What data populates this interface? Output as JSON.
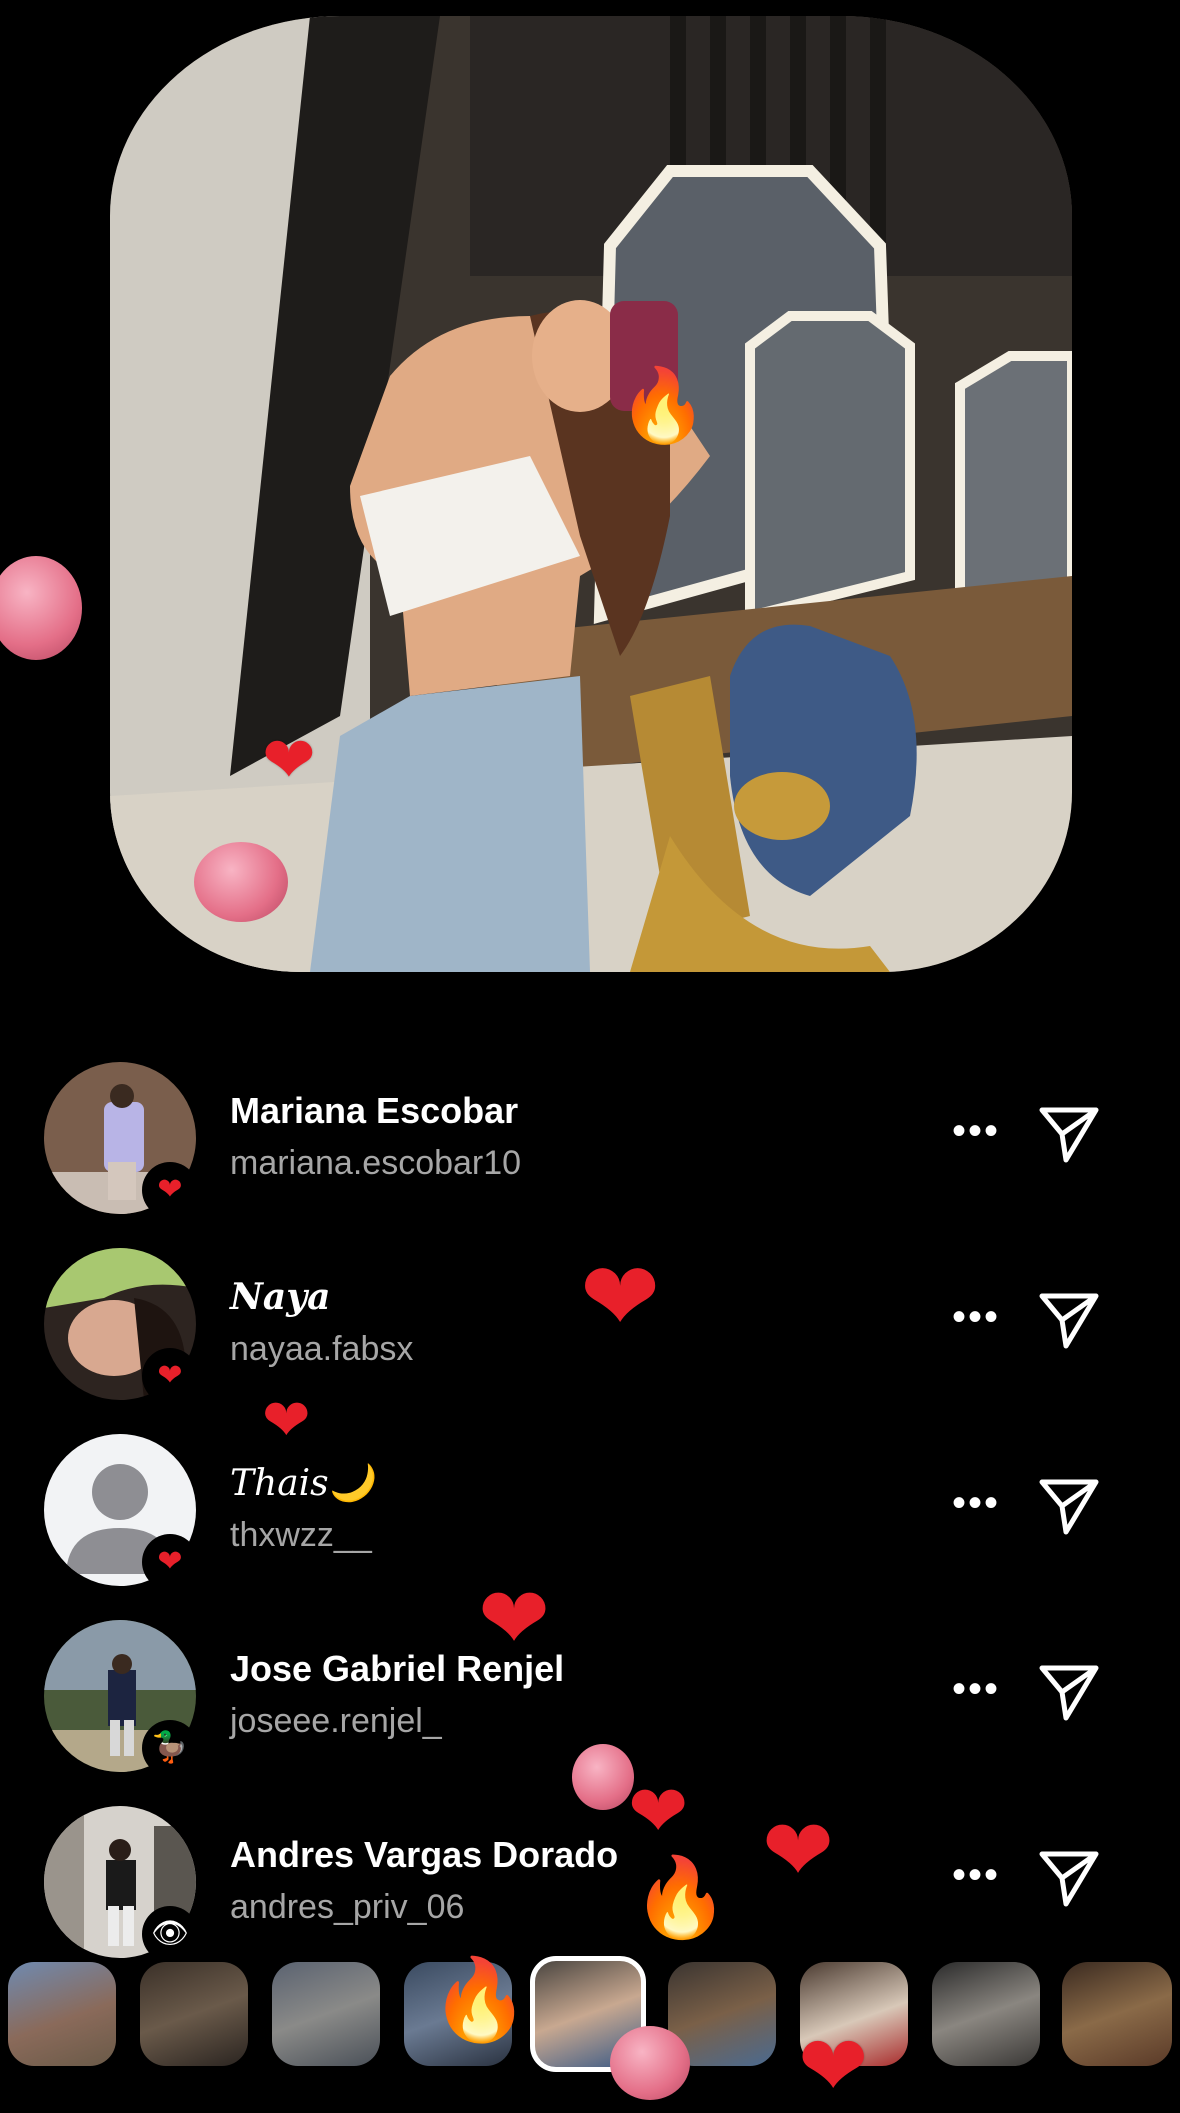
{
  "viewers": [
    {
      "name": "Mariana Escobar",
      "username": "mariana.escobar10",
      "reaction_icon": "heart",
      "name_style": "bold"
    },
    {
      "name": "𝑵𝒂𝒚𝒂",
      "username": "nayaa.fabsx",
      "reaction_icon": "heart",
      "name_style": "bold"
    },
    {
      "name": "Thais🌙",
      "username": "thxwzz__",
      "reaction_icon": "heart",
      "name_style": "italic"
    },
    {
      "name": "Jose Gabriel Renjel",
      "username": "joseee.renjel_",
      "reaction_icon": "duck",
      "name_style": "bold"
    },
    {
      "name": "Andres Vargas Dorado",
      "username": "andres_priv_06",
      "reaction_icon": "eye",
      "name_style": "bold"
    }
  ],
  "more_glyph": "•••",
  "reaction_glyphs": {
    "heart": "❤",
    "duck": "🦆",
    "eye": "👁",
    "fire": "🔥"
  },
  "colors": {
    "background": "#000000",
    "secondary_text": "#a6a6a6",
    "heart": "#e8202a"
  }
}
